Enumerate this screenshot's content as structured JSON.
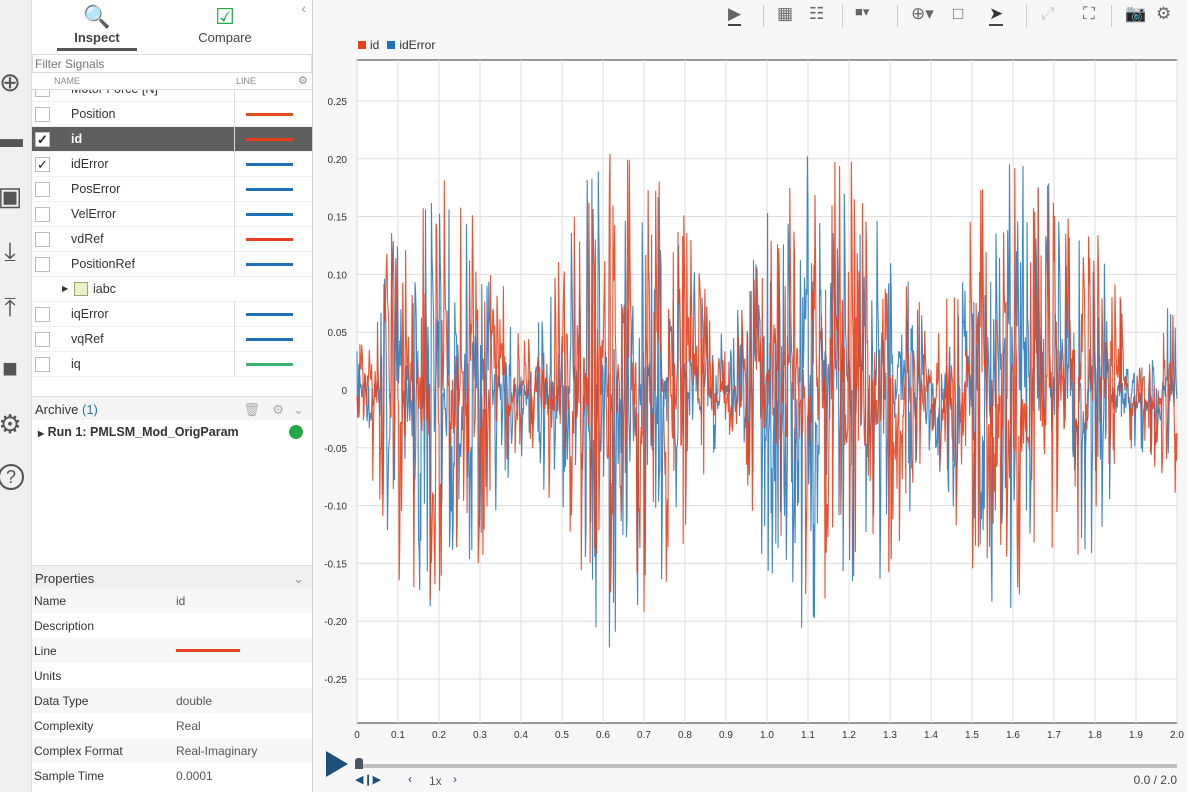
{
  "iconbar": [
    {
      "icon": "add-icon"
    },
    {
      "icon": "folder-icon"
    },
    {
      "icon": "save-icon"
    },
    {
      "icon": "download-icon"
    },
    {
      "icon": "upload-icon"
    },
    {
      "icon": "document-icon"
    },
    {
      "icon": "settings-icon"
    },
    {
      "icon": "help-icon"
    }
  ],
  "tabs": {
    "inspect": "Inspect",
    "compare": "Compare"
  },
  "filter": {
    "placeholder": "Filter Signals"
  },
  "signal_table": {
    "col_name": "NAME",
    "col_line": "LINE",
    "rows": [
      {
        "name": "Motor Force [N]",
        "checked": false,
        "color": ""
      },
      {
        "name": "Position",
        "checked": false,
        "color": "#e0501e"
      },
      {
        "name": "id",
        "checked": true,
        "selected": true,
        "color": "#e8401c"
      },
      {
        "name": "idError",
        "checked": true,
        "color": "#1f72b8"
      },
      {
        "name": "PosError",
        "checked": false,
        "color": "#1f72b8"
      },
      {
        "name": "VelError",
        "checked": false,
        "color": "#1f72b8"
      },
      {
        "name": "vdRef",
        "checked": false,
        "color": "#e8401c"
      },
      {
        "name": "PositionRef",
        "checked": false,
        "color": "#1f72b8"
      },
      {
        "name": "iabc",
        "group": true
      },
      {
        "name": "iqError",
        "checked": false,
        "color": "#1f72b8"
      },
      {
        "name": "vqRef",
        "checked": false,
        "color": "#1f72b8"
      },
      {
        "name": "iq",
        "checked": false,
        "color": "#3cb371"
      }
    ]
  },
  "archive": {
    "label": "Archive",
    "count": "(1)"
  },
  "run": {
    "label": "Run 1: PMLSM_Mod_OrigParam",
    "status_color": "#22aa44"
  },
  "properties": {
    "title": "Properties",
    "rows": [
      {
        "k": "Name",
        "v": "id"
      },
      {
        "k": "Description",
        "v": ""
      },
      {
        "k": "Line",
        "v": "",
        "line": "#e8401c"
      },
      {
        "k": "Units",
        "v": ""
      },
      {
        "k": "Data Type",
        "v": "double"
      },
      {
        "k": "Complexity",
        "v": "Real"
      },
      {
        "k": "Complex Format",
        "v": "Real-Imaginary"
      },
      {
        "k": "Sample Time",
        "v": "0.0001"
      }
    ]
  },
  "player": {
    "speed": "1x",
    "time": "0.0 / 2.0",
    "progress": 0
  },
  "chart_data": {
    "type": "line",
    "xlim": [
      0,
      2.0
    ],
    "ylim": [
      -0.3,
      0.28
    ],
    "grid": true,
    "legend": "top-left",
    "xticks": [
      "0",
      "0.1",
      "0.2",
      "0.3",
      "0.4",
      "0.5",
      "0.6",
      "0.7",
      "0.8",
      "0.9",
      "1.0",
      "1.1",
      "1.2",
      "1.3",
      "1.4",
      "1.5",
      "1.6",
      "1.7",
      "1.8",
      "1.9",
      "2.0"
    ],
    "yticks": [
      "0.25",
      "0.20",
      "0.15",
      "0.10",
      "0.05",
      "0",
      "-0.05",
      "-0.10",
      "-0.15",
      "-0.20",
      "-0.25"
    ],
    "envelope_x": [
      0,
      0.1,
      0.2,
      0.3,
      0.4,
      0.5,
      0.6,
      0.7,
      0.8,
      0.9,
      1.0,
      1.1,
      1.2,
      1.3,
      1.4,
      1.5,
      1.6,
      1.7,
      1.8,
      1.9,
      2.0
    ],
    "series": [
      {
        "name": "id",
        "color": "#e8401c",
        "amplitude_envelope": [
          0.03,
          0.17,
          0.2,
          0.15,
          0.05,
          0.12,
          0.24,
          0.2,
          0.15,
          0.03,
          0.15,
          0.2,
          0.2,
          0.16,
          0.05,
          0.17,
          0.2,
          0.18,
          0.15,
          0.04,
          0.1
        ]
      },
      {
        "name": "idError",
        "color": "#1f72b8",
        "amplitude_envelope": [
          0.04,
          0.15,
          0.2,
          0.14,
          0.06,
          0.12,
          0.24,
          0.2,
          0.15,
          0.04,
          0.16,
          0.22,
          0.18,
          0.16,
          0.06,
          0.17,
          0.2,
          0.18,
          0.15,
          0.05,
          0.09
        ]
      }
    ]
  }
}
